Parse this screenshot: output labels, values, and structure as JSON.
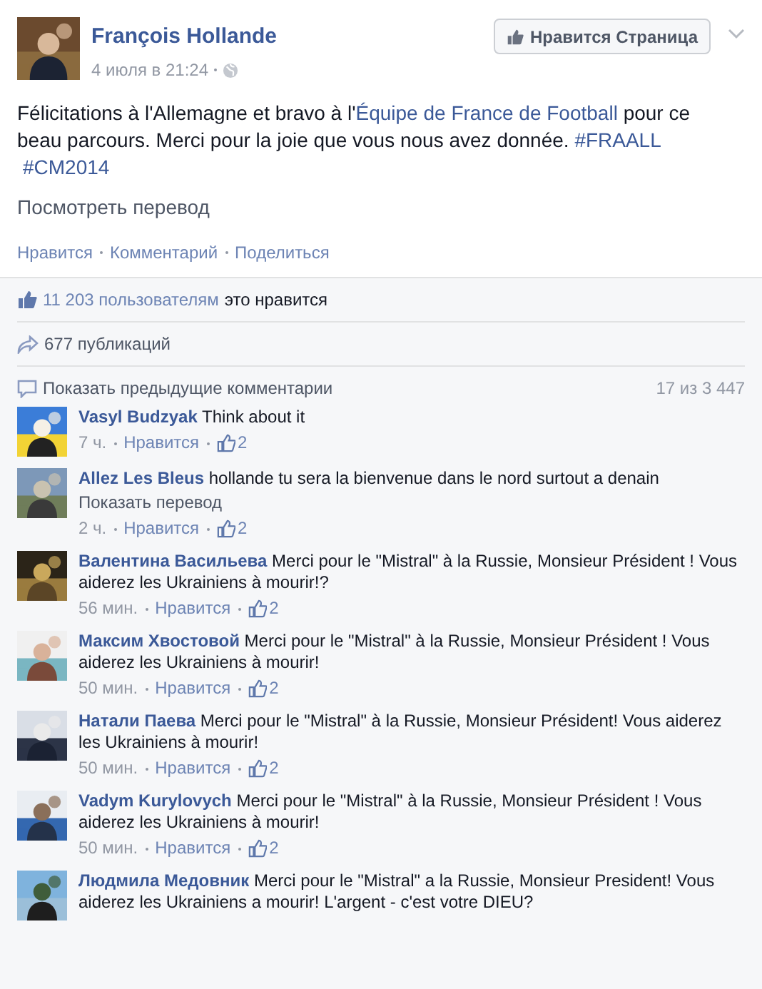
{
  "post": {
    "author": "François Hollande",
    "time": "4 июля в 21:24",
    "like_page_button": "Нравится Страница",
    "text": [
      {
        "kind": "text",
        "text": "Félicitations à l'Allemagne et bravo à l'"
      },
      {
        "kind": "link",
        "text": "Équipe de France de Football"
      },
      {
        "kind": "text",
        "text": " pour ce beau parcours. Merci pour la joie que vous nous avez donnée. "
      },
      {
        "kind": "link",
        "text": "#FRAALL"
      },
      {
        "kind": "link",
        "text": "#CM2014"
      }
    ],
    "translate_link": "Посмотреть перевод",
    "actions": [
      "Нравится",
      "Комментарий",
      "Поделиться"
    ]
  },
  "likes": {
    "count": "11 203 пользователям",
    "suffix": "это нравится"
  },
  "shares": "677 публикаций",
  "comments_header": {
    "show_previous": "Показать предыдущие комментарии",
    "counter": "17 из 3 447"
  },
  "comments": [
    {
      "author": "Vasyl Budzyak",
      "text": "Think about it",
      "time": "7 ч.",
      "like": "Нравится",
      "likes": "2"
    },
    {
      "author": "Allez Les Bleus",
      "text": "hollande tu sera la bienvenue dans le nord surtout a denain",
      "translate": "Показать перевод",
      "time": "2 ч.",
      "like": "Нравится",
      "likes": "2"
    },
    {
      "author": "Валентина Васильева",
      "text": "Merci pour le \"Mistral\" à la Russie, Monsieur Président ! Vous aiderez les Ukrainiens à mourir!?",
      "time": "56 мин.",
      "like": "Нравится",
      "likes": "2"
    },
    {
      "author": "Максим Хвостовой",
      "text": "Merci pour le \"Mistral\" à la Russie, Monsieur Président ! Vous aiderez les Ukrainiens à mourir!",
      "time": "50 мин.",
      "like": "Нравится",
      "likes": "2"
    },
    {
      "author": "Натали Паева",
      "text": "Merci pour le \"Mistral\" à la Russie, Monsieur Président! Vous aiderez les Ukrainiens à mourir!",
      "time": "50 мин.",
      "like": "Нравится",
      "likes": "2"
    },
    {
      "author": "Vadym Kurylovych",
      "text": "Merci pour le \"Mistral\" à la Russie, Monsieur Président ! Vous aiderez les Ukrainiens à mourir!",
      "time": "50 мин.",
      "like": "Нравится",
      "likes": "2"
    },
    {
      "author": "Людмила Медовник",
      "text": "Merci pour le \"Mistral\" a la Russie, Monsieur President! Vous aiderez les Ukrainiens a mourir! L'argent - c'est votre DIEU?"
    }
  ]
}
